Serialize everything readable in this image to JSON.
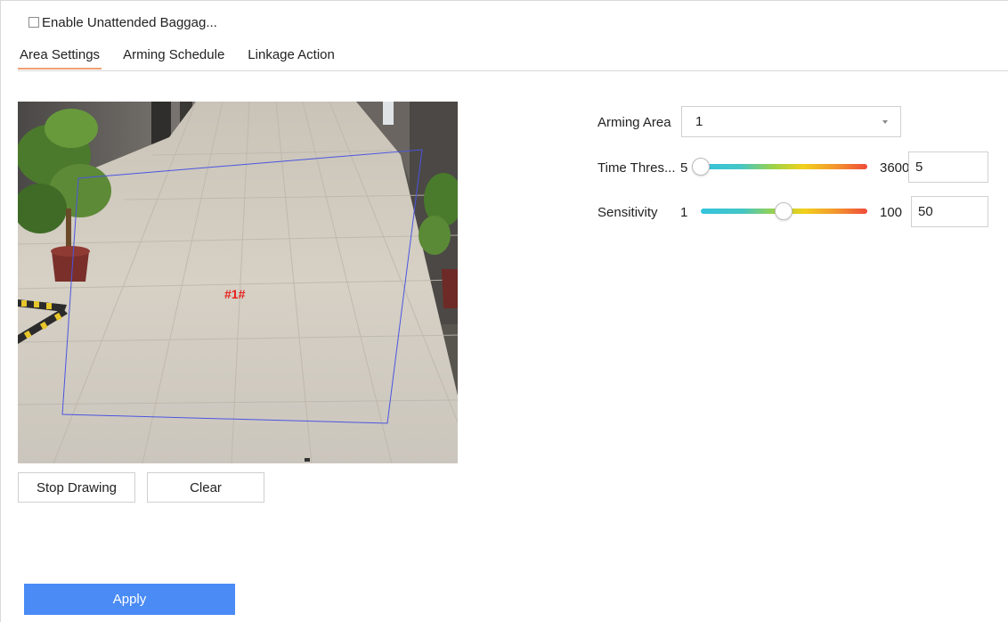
{
  "enable": {
    "label": "Enable Unattended Baggag...",
    "checked": false
  },
  "tabs": [
    {
      "label": "Area Settings",
      "active": true
    },
    {
      "label": "Arming Schedule",
      "active": false
    },
    {
      "label": "Linkage Action",
      "active": false
    }
  ],
  "video": {
    "region_label": "#1#",
    "region_label_color": "#e8201a",
    "region_outline_color": "#4b55e0"
  },
  "buttons": {
    "stop_drawing": "Stop Drawing",
    "clear": "Clear",
    "apply": "Apply"
  },
  "arming_area": {
    "label": "Arming Area",
    "value": "1"
  },
  "time_threshold": {
    "label": "Time Thres...",
    "min": "5",
    "max": "3600",
    "value": "5"
  },
  "sensitivity": {
    "label": "Sensitivity",
    "min": "1",
    "max": "100",
    "value": "50"
  },
  "colors": {
    "accent": "#4a8bf5",
    "tab_underline": "#f0a074"
  }
}
